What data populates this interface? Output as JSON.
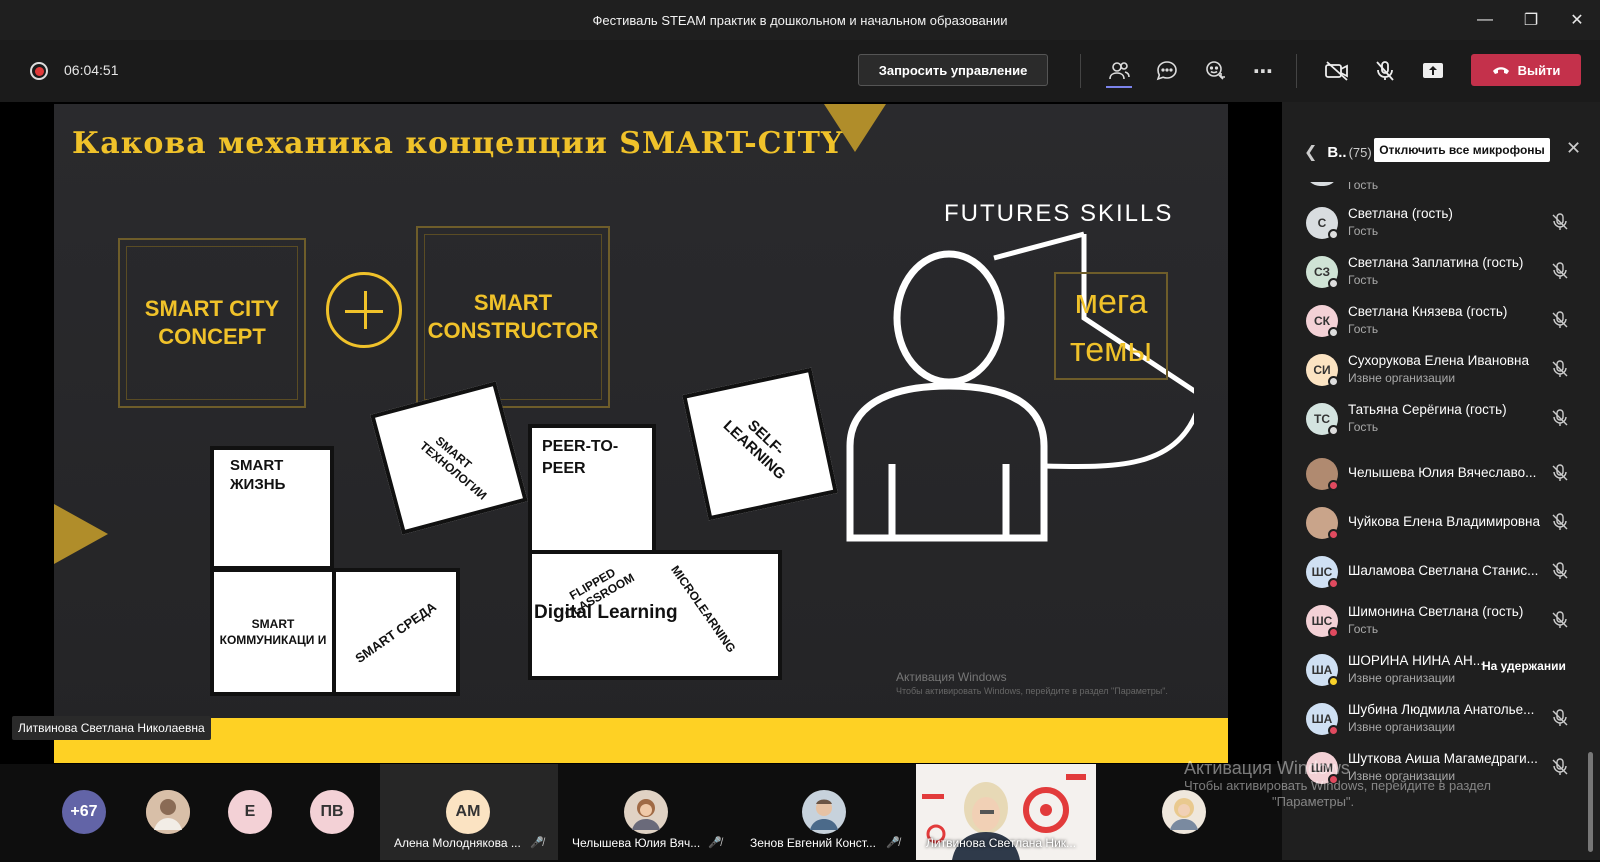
{
  "window": {
    "title": "Фестиваль STEAM практик в дошкольном и начальном образовании"
  },
  "toolbar": {
    "timer": "06:04:51",
    "request_control": "Запросить управление",
    "leave": "Выйти"
  },
  "slide": {
    "title": "Какова механика концепции  SMART-CITY",
    "box1": "SMART CITY CONCEPT",
    "box2": "SMART CONSTRUCTOR",
    "futures": "FUTURES SKILLS",
    "mega": "мега темы",
    "p_life": "SMART ЖИЗНЬ",
    "p_tech": "SMART ТЕХНОЛОГИИ",
    "p_comm": "SMART КОММУНИКАЦИ И",
    "p_env": "SMART СРЕДА",
    "p_peer": "PEER-TO- PEER",
    "p_self": "SELF- LEARNING",
    "p_flip": "FLIPPED CLASSROOM",
    "p_digital": "Digital Learning",
    "p_micro": "MICROLEARNING",
    "watermark": "Активация Windows",
    "watermark_sub": "Чтобы активировать Windows, перейдите в раздел \"Параметры\"."
  },
  "speaker": "Литвинова Светлана Николаевна",
  "sidebar": {
    "title": "В..",
    "count": "(75)",
    "mute_all": "Отключить все микрофоны",
    "partial_top": "Гость",
    "participants": [
      {
        "initials": "С",
        "name": "Светлана (гость)",
        "sub": "Гость",
        "color": "#d9dde0"
      },
      {
        "initials": "СЗ",
        "name": "Светлана Заплатина (гость)",
        "sub": "Гость",
        "color": "#cfe3d5"
      },
      {
        "initials": "СК",
        "name": "Светлана Князева (гость)",
        "sub": "Гость",
        "color": "#f3d1d6"
      },
      {
        "initials": "СИ",
        "name": "Сухорукова Елена Ивановна",
        "sub": "Извне организации",
        "color": "#fbe3c2"
      },
      {
        "initials": "ТС",
        "name": "Татьяна Серёгина (гость)",
        "sub": "Гость",
        "color": "#d4e4e0"
      },
      {
        "initials": "",
        "name": "Челышева Юлия Вячеславо...",
        "sub": "",
        "color": "#b08a70"
      },
      {
        "initials": "",
        "name": "Чуйкова Елена Владимировна",
        "sub": "",
        "color": "#c9a48a"
      },
      {
        "initials": "ШС",
        "name": "Шаламова Светлана Станис...",
        "sub": "",
        "color": "#cfe0f3"
      },
      {
        "initials": "ШС",
        "name": "Шимонина Светлана (гость)",
        "sub": "Гость",
        "color": "#f3d1d6"
      },
      {
        "initials": "ША",
        "name": "ШОРИНА НИНА АН...",
        "sub": "Извне организации",
        "color": "#cfe0f3",
        "hold": "На удержании"
      },
      {
        "initials": "ША",
        "name": "Шубина Людмила Анатолье...",
        "sub": "Извне организации",
        "color": "#cfe0f3"
      },
      {
        "initials": "ШМ",
        "name": "Шуткова Аиша Магамедраги...",
        "sub": "Извне организации",
        "color": "#f3d1d6"
      }
    ]
  },
  "strip": {
    "more": "+67",
    "e": "Е",
    "pv": "ПВ",
    "am": "АМ",
    "t1": "Алена Молоднякова ...",
    "t2": "Челышева Юлия Вяч...",
    "t3": "Зенов Евгений Конст...",
    "t4": "Литвинова Светлана Ник..."
  },
  "os_watermark": {
    "line1": "Активация Windows",
    "line2": "Чтобы активировать Windows, перейдите в раздел",
    "line3": "\"Параметры\"."
  }
}
